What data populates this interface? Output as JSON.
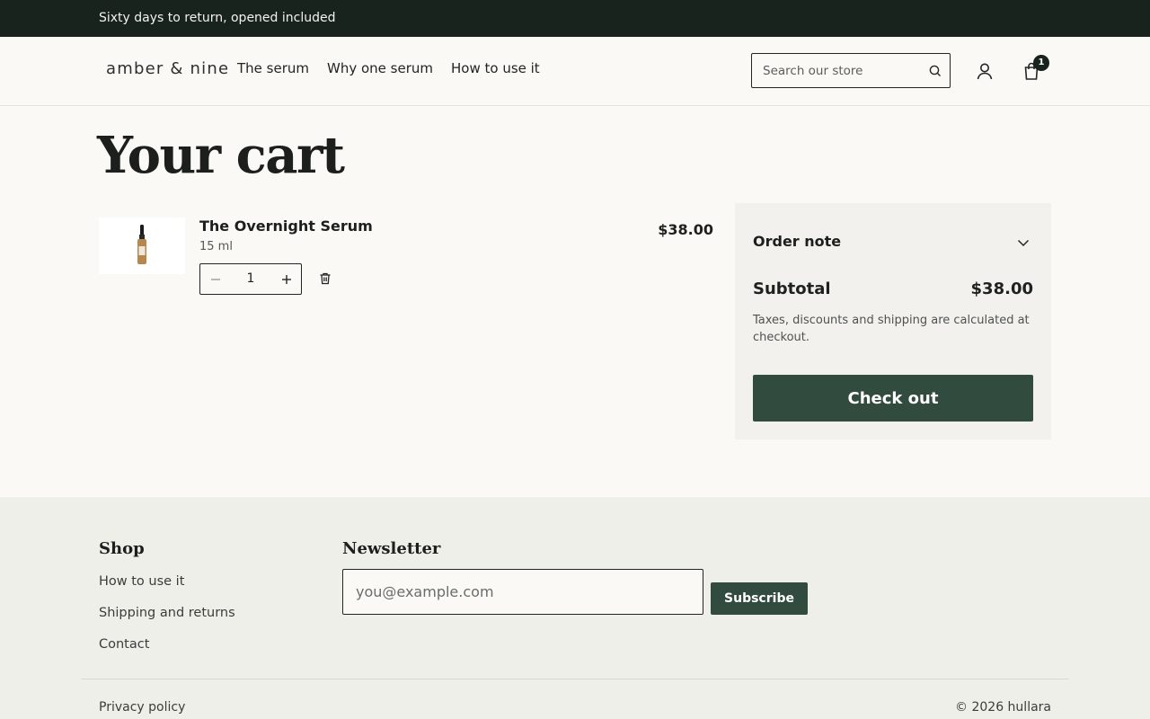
{
  "announcement": "Sixty days to return, opened included",
  "header": {
    "logo": "amber & nine",
    "nav": [
      "The serum",
      "Why one serum",
      "How to use it"
    ],
    "search_placeholder": "Search our store",
    "cart_count": "1"
  },
  "cart": {
    "title": "Your cart",
    "item": {
      "name": "The Overnight Serum",
      "variant": "15 ml",
      "quantity": "1",
      "price": "$38.00"
    }
  },
  "summary": {
    "order_note_label": "Order note",
    "subtotal_label": "Subtotal",
    "subtotal_value": "$38.00",
    "tax_note": "Taxes, discounts and shipping are calculated at checkout.",
    "checkout_label": "Check out"
  },
  "footer": {
    "shop_heading": "Shop",
    "shop_links": [
      "How to use it",
      "Shipping and returns",
      "Contact"
    ],
    "newsletter_heading": "Newsletter",
    "newsletter_placeholder": "you@example.com",
    "subscribe_label": "Subscribe",
    "privacy_label": "Privacy policy",
    "copyright": "© 2026 hullara"
  },
  "colors": {
    "dark": "#18231d",
    "accent": "#314b3f",
    "background": "#faf9f6",
    "panel": "#f2f1ed"
  }
}
